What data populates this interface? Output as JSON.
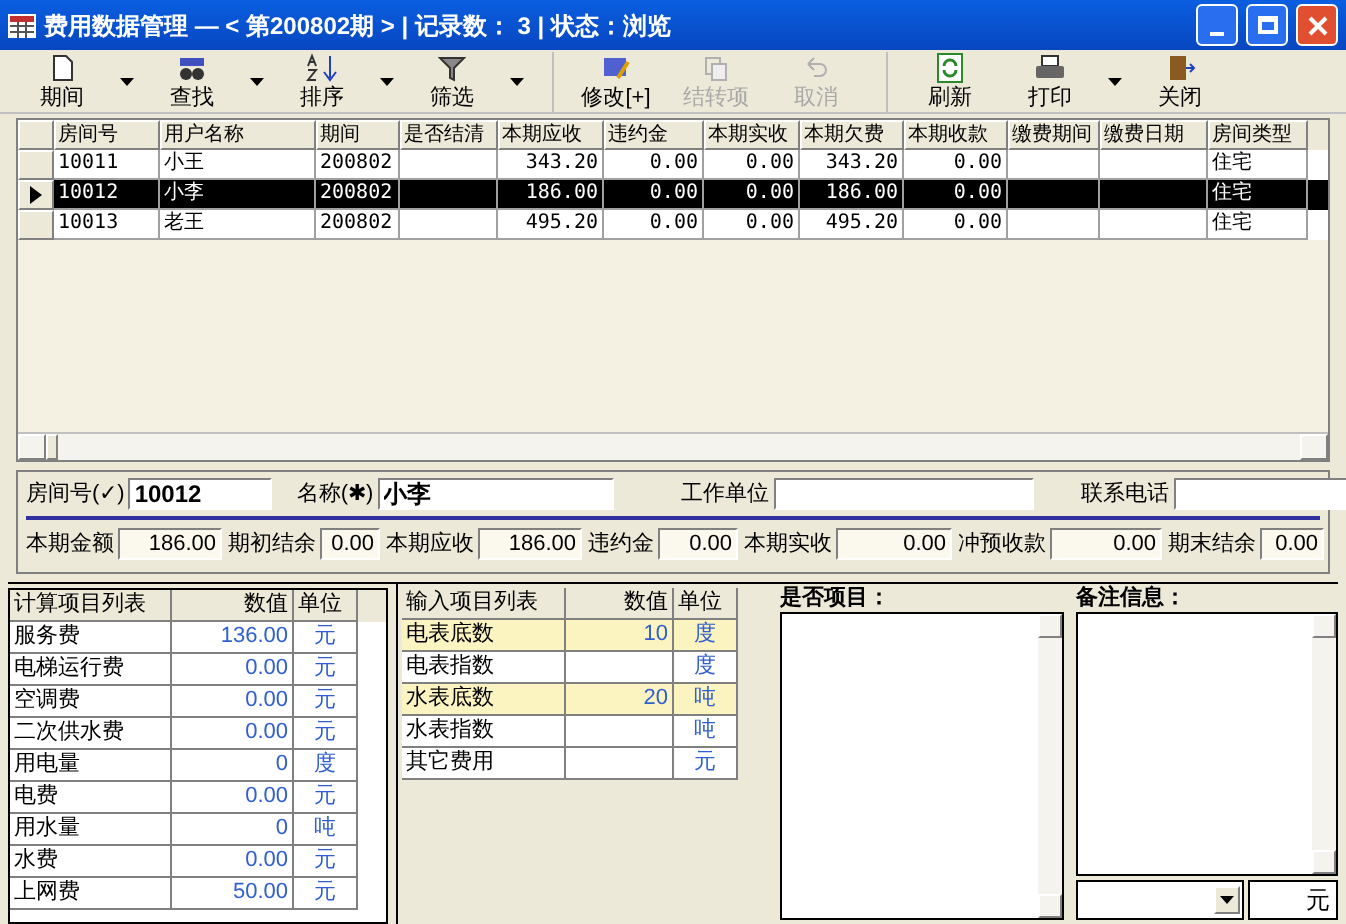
{
  "window": {
    "title": "费用数据管理 — < 第200802期 > | 记录数： 3 | 状态：浏览"
  },
  "toolbar": [
    {
      "label": "期间",
      "dropdown": true,
      "disabled": false
    },
    {
      "label": "查找",
      "dropdown": true,
      "disabled": false
    },
    {
      "label": "排序",
      "dropdown": true,
      "disabled": false
    },
    {
      "label": "筛选",
      "dropdown": true,
      "disabled": false
    },
    {
      "label": "修改[+]",
      "dropdown": false,
      "disabled": false
    },
    {
      "label": "结转项",
      "dropdown": false,
      "disabled": true
    },
    {
      "label": "取消",
      "dropdown": false,
      "disabled": true
    },
    {
      "label": "刷新",
      "dropdown": false,
      "disabled": false
    },
    {
      "label": "打印",
      "dropdown": true,
      "disabled": false
    },
    {
      "label": "关闭",
      "dropdown": false,
      "disabled": false
    }
  ],
  "table": {
    "columns": [
      "房间号",
      "用户名称",
      "期间",
      "是否结清",
      "本期应收",
      "违约金",
      "本期实收",
      "本期欠费",
      "本期收款",
      "缴费期间",
      "缴费日期",
      "房间类型"
    ],
    "rows": [
      {
        "selected": false,
        "cells": [
          "10011",
          "小王",
          "200802",
          "",
          "343.20",
          "0.00",
          "0.00",
          "343.20",
          "0.00",
          "",
          "",
          "住宅"
        ]
      },
      {
        "selected": true,
        "cells": [
          "10012",
          "小李",
          "200802",
          "",
          "186.00",
          "0.00",
          "0.00",
          "186.00",
          "0.00",
          "",
          "",
          "住宅"
        ]
      },
      {
        "selected": false,
        "cells": [
          "10013",
          "老王",
          "200802",
          "",
          "495.20",
          "0.00",
          "0.00",
          "495.20",
          "0.00",
          "",
          "",
          "住宅"
        ]
      }
    ]
  },
  "detail": {
    "fields": [
      {
        "label": "房间号(✓)",
        "value": "10012"
      },
      {
        "label": "名称(✱)",
        "value": "小李"
      },
      {
        "label": "工作单位"
      },
      {
        "label": "联系电话"
      }
    ],
    "amounts": [
      {
        "label": "本期金额",
        "value": "186.00"
      },
      {
        "label": "期初结余",
        "value": "0.00"
      },
      {
        "label": "本期应收",
        "value": "186.00"
      },
      {
        "label": "违约金",
        "value": "0.00"
      },
      {
        "label": "本期实收",
        "value": "0.00"
      },
      {
        "label": "冲预收款",
        "value": "0.00"
      },
      {
        "label": "期末结余",
        "value": "0.00"
      }
    ]
  },
  "calc_items": {
    "columns": [
      "计算项目列表",
      "数值",
      "单位"
    ],
    "rows": [
      [
        "服务费",
        "136.00",
        "元"
      ],
      [
        "电梯运行费",
        "0.00",
        "元"
      ],
      [
        "空调费",
        "0.00",
        "元"
      ],
      [
        "二次供水费",
        "0.00",
        "元"
      ],
      [
        "用电量",
        "0",
        "度"
      ],
      [
        "电费",
        "0.00",
        "元"
      ],
      [
        "用水量",
        "0",
        "吨"
      ],
      [
        "水费",
        "0.00",
        "元"
      ],
      [
        "上网费",
        "50.00",
        "元"
      ]
    ]
  },
  "input_items": {
    "columns": [
      "输入项目列表",
      "数值",
      "单位"
    ],
    "rows": [
      {
        "highlighted": true,
        "cells": [
          "电表底数",
          "10",
          "度"
        ]
      },
      {
        "highlighted": false,
        "cells": [
          "电表指数",
          "",
          "度"
        ]
      },
      {
        "highlighted": true,
        "cells": [
          "水表底数",
          "20",
          "吨"
        ]
      },
      {
        "highlighted": false,
        "cells": [
          "水表指数",
          "",
          "吨"
        ]
      },
      {
        "highlighted": false,
        "cells": [
          "其它费用",
          "",
          "元"
        ]
      }
    ]
  },
  "flags_label": "是否项目：",
  "notes_label": "备注信息：",
  "currency_unit": "元"
}
